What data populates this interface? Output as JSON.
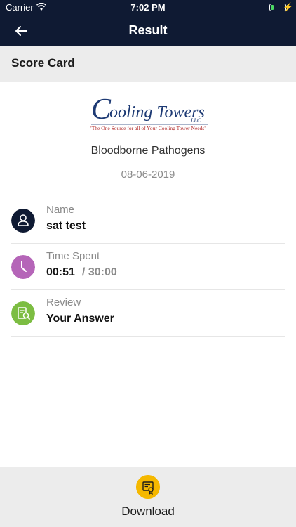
{
  "status_bar": {
    "carrier": "Carrier",
    "time": "7:02 PM",
    "battery_level_percent": 20
  },
  "nav": {
    "title": "Result",
    "back_icon": "arrow-left-icon"
  },
  "section": {
    "title": "Score Card"
  },
  "logo": {
    "brand": "Cooling Towers",
    "suffix": "LLC.",
    "tagline": "\"The One Source for all of Your Cooling Tower Needs\""
  },
  "course": {
    "name": "Bloodborne Pathogens",
    "date": "08-06-2019"
  },
  "rows": [
    {
      "label": "Name",
      "value": "sat test",
      "icon": "user-icon",
      "color": "#0f1a33"
    },
    {
      "label": "Time Spent",
      "value": "00:51",
      "total": "/ 30:00",
      "icon": "clock-icon",
      "color": "#b565b8"
    },
    {
      "label": "Review",
      "value": "Your Answer",
      "icon": "review-document-icon",
      "color": "#7cbd42"
    }
  ],
  "footer": {
    "download_label": "Download",
    "download_icon": "certificate-download-icon",
    "icon_color": "#f5b800"
  }
}
